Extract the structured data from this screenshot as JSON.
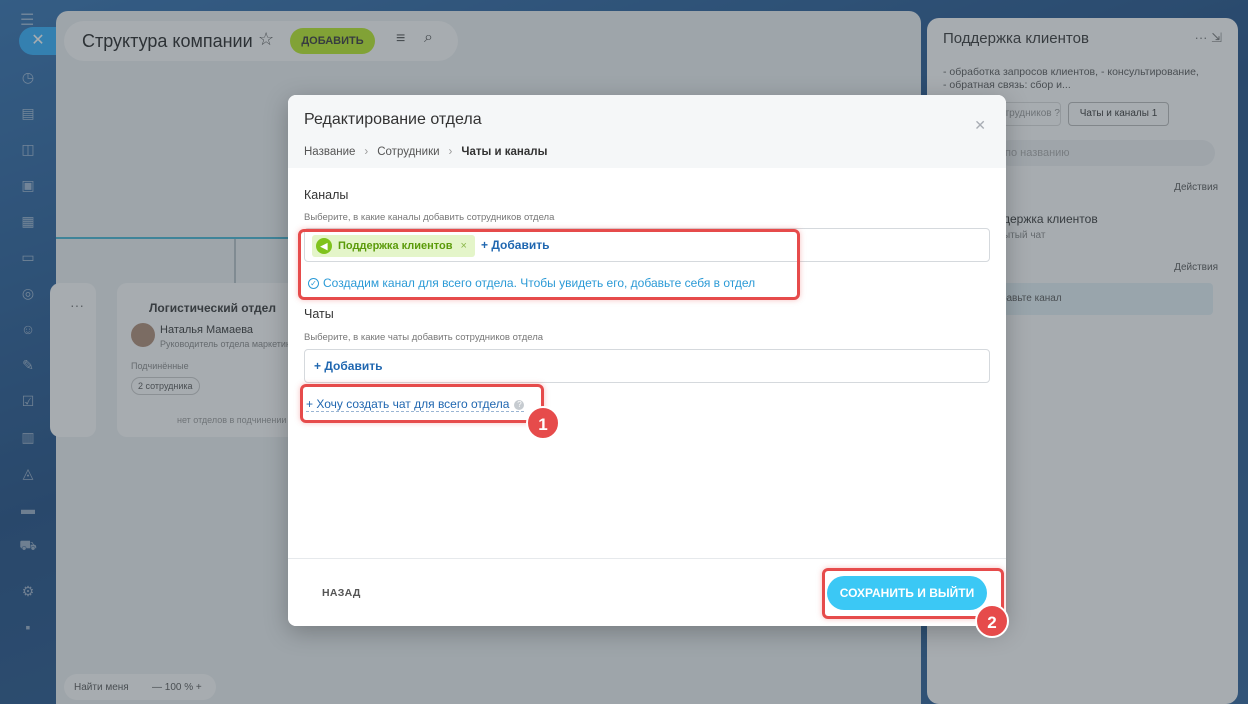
{
  "page": {
    "title": "Структура компании",
    "add_button": "ДОБАВИТЬ",
    "card": {
      "title": "Логистический отдел",
      "person_name": "Наталья Мамаева",
      "person_role": "Руководитель отдела маркетинга",
      "subordinates_label": "Подчинённые",
      "count_badge": "2 сотрудника",
      "no_departments": "нет отделов в подчинении"
    },
    "zoom": {
      "find_me": "Найти меня",
      "value": "— 100 % +"
    }
  },
  "right_panel": {
    "title": "Поддержка клиентов",
    "description": "- обработка запросов клиентов, - консультирование, - обратная связь: сбор и...",
    "tab_employees": "Сотрудников ?",
    "tab_chats": "Чаты и каналы 1",
    "search_placeholder": "по названию",
    "actions_label": "Действия",
    "item_title": "держка клиентов",
    "item_sub": "ытый чат",
    "hint": "бавьте канал"
  },
  "modal": {
    "title": "Редактирование отдела",
    "breadcrumbs": [
      "Название",
      "Сотрудники",
      "Чаты и каналы"
    ],
    "channels": {
      "title": "Каналы",
      "hint": "Выберите, в какие каналы добавить сотрудников отдела",
      "tag": "Поддержка клиентов",
      "add": "+ Добавить",
      "note": "Создадим канал для всего отдела. Чтобы увидеть его, добавьте себя в отдел"
    },
    "chats": {
      "title": "Чаты",
      "hint": "Выберите, в какие чаты добавить сотрудников отдела",
      "add": "+ Добавить",
      "create_link": "+ Хочу создать чат для всего отдела"
    },
    "back": "НАЗАД",
    "save": "СОХРАНИТЬ И ВЫЙТИ"
  },
  "annotations": {
    "badge1": "1",
    "badge2": "2"
  },
  "colors": {
    "accent": "#3bc8f5",
    "add_green": "#bbed21",
    "highlight": "#e64b4b",
    "link": "#2067b0"
  }
}
